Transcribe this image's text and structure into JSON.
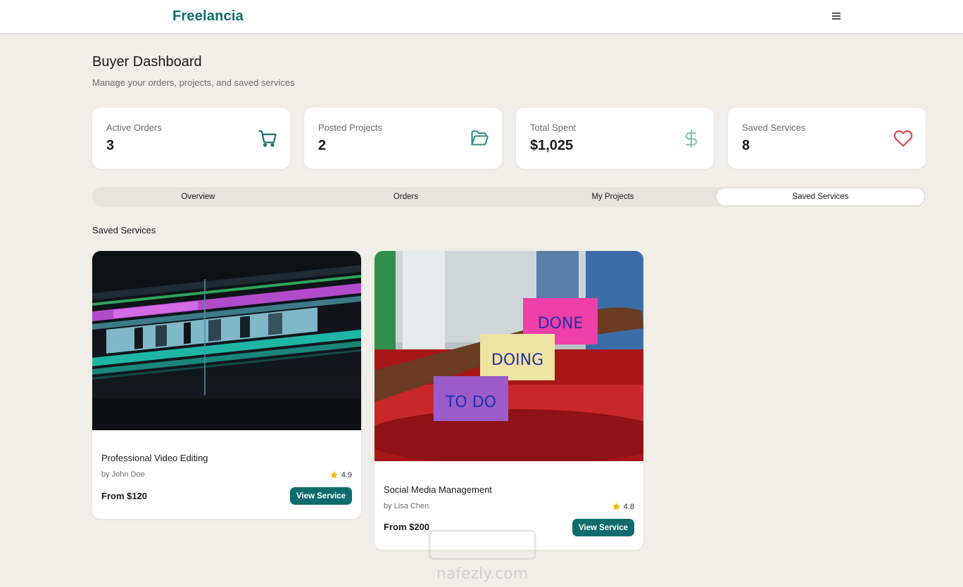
{
  "brand": {
    "logo": "Freelancia",
    "accent": "#0f6b6c",
    "menu_icon": "hamburger-icon"
  },
  "header": {
    "title": "Buyer Dashboard",
    "subtitle": "Manage your orders, projects, and saved services"
  },
  "stats": [
    {
      "label": "Active Orders",
      "value": "3",
      "icon": "cart-icon",
      "icon_color": "#0f6b6c"
    },
    {
      "label": "Posted Projects",
      "value": "2",
      "icon": "folder-open-icon",
      "icon_color": "#2a8f8a"
    },
    {
      "label": "Total Spent",
      "value": "$1,025",
      "icon": "dollar-icon",
      "icon_color": "#7fbfb7"
    },
    {
      "label": "Saved Services",
      "value": "8",
      "icon": "heart-icon",
      "icon_color": "#e0454d"
    }
  ],
  "tabs": [
    {
      "label": "Overview",
      "active": false
    },
    {
      "label": "Orders",
      "active": false
    },
    {
      "label": "My Projects",
      "active": false
    },
    {
      "label": "Saved Services",
      "active": true
    }
  ],
  "section": {
    "title": "Saved Services"
  },
  "services": [
    {
      "title": "Professional Video Editing",
      "author": "by John Doe",
      "rating": "4.9",
      "price": "From $120",
      "button": "View Service",
      "image": "video-editing-timeline-image"
    },
    {
      "title": "Social Media Management",
      "author": "by Lisa Chen",
      "rating": "4.8",
      "price": "From $200",
      "button": "View Service",
      "image": "sticky-notes-todo-image",
      "notes": [
        "DONE",
        "DOING",
        "TO DO"
      ]
    }
  ],
  "watermark": {
    "text": "nafezly.com"
  }
}
